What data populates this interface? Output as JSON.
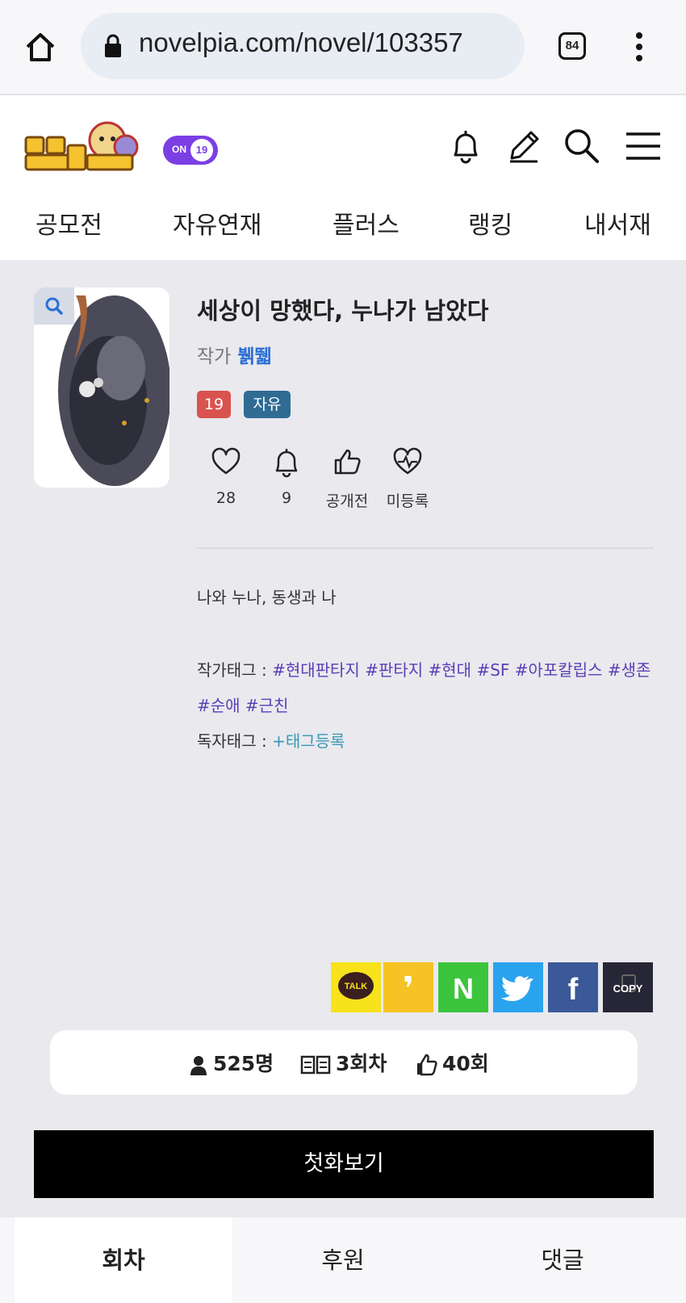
{
  "browser": {
    "url": "novelpia.com/novel/103357",
    "tab_count": "84"
  },
  "header": {
    "on_toggle_label": "ON",
    "age_badge": "19"
  },
  "nav": {
    "items": [
      "공모전",
      "자유연재",
      "플러스",
      "랭킹",
      "내서재"
    ]
  },
  "novel": {
    "title": "세상이 망했다, 누나가 남았다",
    "author_label": "작가",
    "author_name": "뷁뛟",
    "badges": [
      "19",
      "자유"
    ],
    "stats": [
      {
        "icon": "heart-icon",
        "value": "28"
      },
      {
        "icon": "bell-icon",
        "value": "9"
      },
      {
        "icon": "thumbs-up-icon",
        "value": "공개전"
      },
      {
        "icon": "heartbeat-icon",
        "value": "미등록"
      }
    ],
    "synopsis": "나와 누나, 동생과 나",
    "author_tags_label": "작가태그 : ",
    "author_tags": [
      "#현대판타지",
      "#판타지",
      "#현대",
      "#SF",
      "#아포칼립스",
      "#생존",
      "#순애",
      "#근친"
    ],
    "reader_tags_label": "독자태그 : ",
    "reader_tag_add": "+태그등록"
  },
  "share": {
    "kakao_label": "TALK",
    "kakaostory_label": "❜",
    "naver_label": "N",
    "twitter_label": "twitter",
    "facebook_label": "f",
    "copy_label": "COPY"
  },
  "counts": {
    "readers": "525명",
    "episodes": "3회차",
    "recommends": "40회"
  },
  "first_episode_button": "첫화보기",
  "bottom_tabs": [
    "회차",
    "후원",
    "댓글"
  ],
  "colors": {
    "accent_purple": "#7b3fe4",
    "age_badge_red": "#d9534f",
    "free_badge_blue": "#2f6b93",
    "author_blue": "#2b6fd6",
    "tag_purple": "#5b3fb5"
  }
}
